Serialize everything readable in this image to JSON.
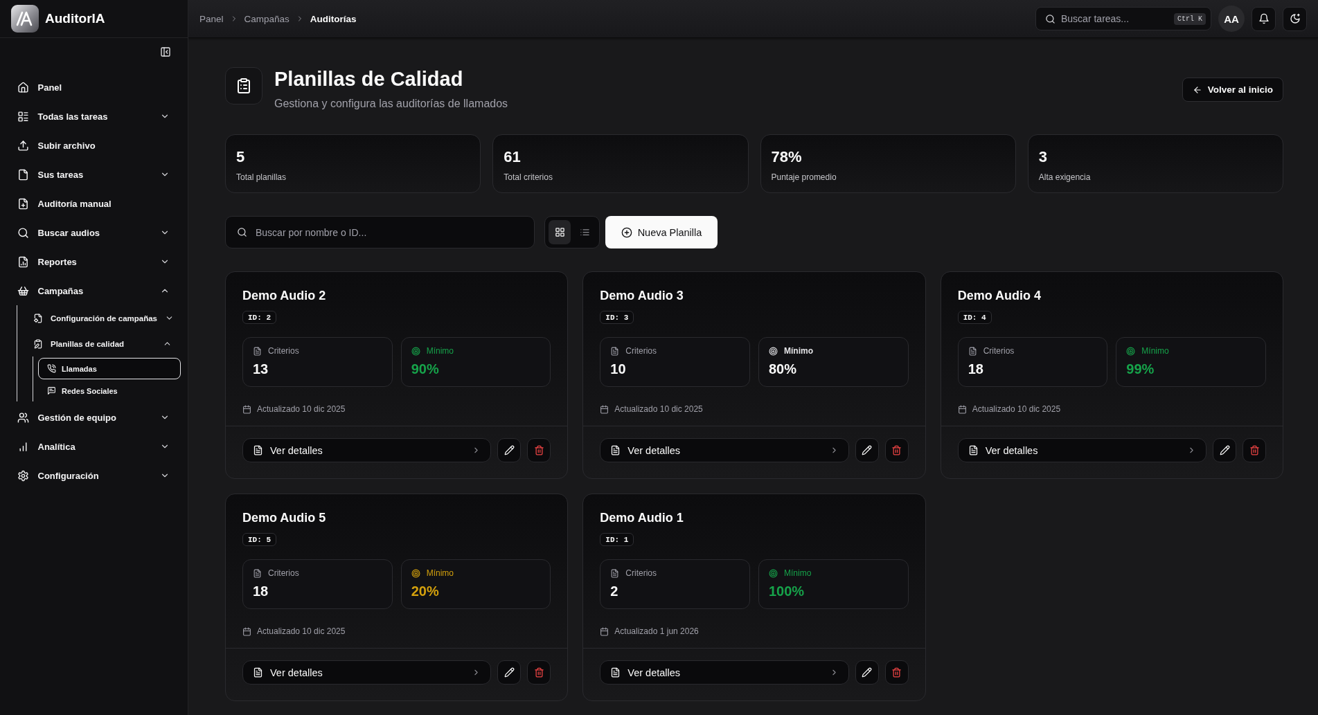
{
  "sidebar": {
    "brand": "AuditorIA",
    "items": [
      {
        "label": "Panel",
        "selected": false
      },
      {
        "label": "Todas las tareas",
        "selected": false,
        "expanded": false
      },
      {
        "label": "Subir archivo",
        "selected": false
      },
      {
        "label": "Sus tareas",
        "selected": false,
        "expanded": false
      },
      {
        "label": "Auditoría manual",
        "selected": false
      },
      {
        "label": "Buscar audios",
        "selected": false,
        "expanded": false
      },
      {
        "label": "Reportes",
        "selected": false,
        "expanded": false
      },
      {
        "label": "Campañas",
        "selected": false,
        "expanded": true,
        "children": [
          {
            "label": "Configuración de campañas",
            "selected": false,
            "expanded": false
          },
          {
            "label": "Planillas de calidad",
            "selected": false,
            "expanded": true,
            "children": [
              {
                "label": "Llamadas",
                "selected": true
              },
              {
                "label": "Redes Sociales",
                "selected": false
              }
            ]
          }
        ]
      },
      {
        "label": "Gestión de equipo",
        "selected": false,
        "expanded": false
      },
      {
        "label": "Analítica",
        "selected": false,
        "expanded": false
      },
      {
        "label": "Configuración",
        "selected": false,
        "expanded": false
      }
    ]
  },
  "topbar": {
    "breadcrumb": [
      {
        "label": "Panel",
        "current": false
      },
      {
        "label": "Campañas",
        "current": false
      },
      {
        "label": "Auditorías",
        "current": true
      }
    ],
    "search": {
      "placeholder": "Buscar tareas...",
      "shortcut": "Ctrl K"
    },
    "avatar": "AA"
  },
  "header": {
    "title": "Planillas de Calidad",
    "subtitle": "Gestiona y configura las auditorías de llamados",
    "back_button": "Volver al inicio"
  },
  "stats": [
    {
      "value": "5",
      "label": "Total planillas"
    },
    {
      "value": "61",
      "label": "Total criterios"
    },
    {
      "value": "78%",
      "label": "Puntaje promedio"
    },
    {
      "value": "3",
      "label": "Alta exigencia"
    }
  ],
  "toolbar": {
    "search": {
      "placeholder": "Buscar por nombre o ID..."
    },
    "view_toggle": [
      {
        "kind": "grid",
        "selected": true
      },
      {
        "kind": "list",
        "selected": false
      }
    ],
    "new_button": "Nueva Planilla"
  },
  "cards": [
    {
      "title": "Demo Audio 2",
      "id_label": "ID: 2",
      "criteria": {
        "label": "Criterios",
        "value": "13"
      },
      "minimum": {
        "label": "Mínimo",
        "value": "90%",
        "kind": "good"
      },
      "updated": "Actualizado 10 dic 2025",
      "details_button": "Ver detalles"
    },
    {
      "title": "Demo Audio 3",
      "id_label": "ID: 3",
      "criteria": {
        "label": "Criterios",
        "value": "10"
      },
      "minimum": {
        "label": "Mínimo",
        "value": "80%",
        "kind": "neutral"
      },
      "updated": "Actualizado 10 dic 2025",
      "details_button": "Ver detalles"
    },
    {
      "title": "Demo Audio 4",
      "id_label": "ID: 4",
      "criteria": {
        "label": "Criterios",
        "value": "18"
      },
      "minimum": {
        "label": "Mínimo",
        "value": "99%",
        "kind": "good"
      },
      "updated": "Actualizado 10 dic 2025",
      "details_button": "Ver detalles"
    },
    {
      "title": "Demo Audio 5",
      "id_label": "ID: 5",
      "criteria": {
        "label": "Criterios",
        "value": "18"
      },
      "minimum": {
        "label": "Mínimo",
        "value": "20%",
        "kind": "warning"
      },
      "updated": "Actualizado 10 dic 2025",
      "details_button": "Ver detalles"
    },
    {
      "title": "Demo Audio 1",
      "id_label": "ID: 1",
      "criteria": {
        "label": "Criterios",
        "value": "2"
      },
      "minimum": {
        "label": "Mínimo",
        "value": "100%",
        "kind": "good"
      },
      "updated": "Actualizado 1 jun 2026",
      "details_button": "Ver detalles"
    }
  ]
}
